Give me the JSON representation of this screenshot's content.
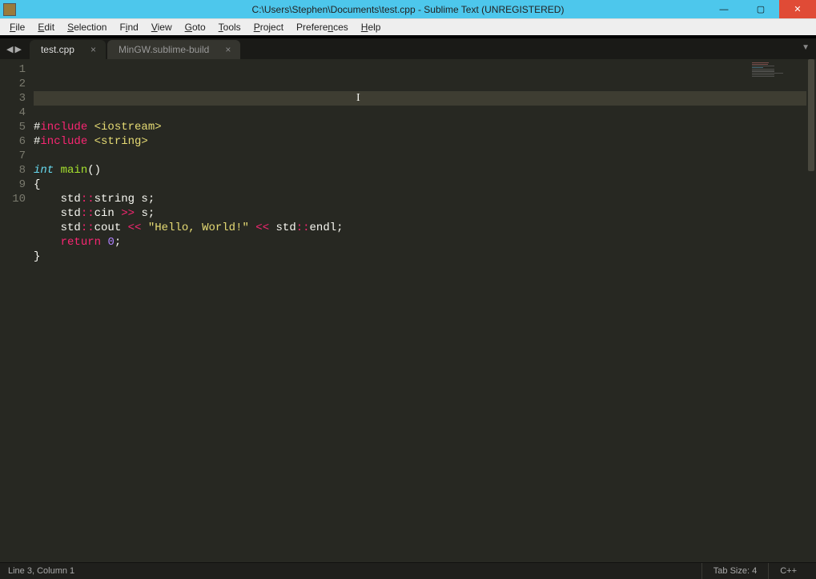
{
  "titlebar": {
    "title": "C:\\Users\\Stephen\\Documents\\test.cpp - Sublime Text (UNREGISTERED)"
  },
  "menu": {
    "items": [
      {
        "u": "F",
        "rest": "ile"
      },
      {
        "u": "E",
        "rest": "dit"
      },
      {
        "u": "S",
        "rest": "election"
      },
      {
        "u": "",
        "rest": "F",
        "u2": "i",
        "rest2": "nd"
      },
      {
        "u": "V",
        "rest": "iew"
      },
      {
        "u": "G",
        "rest": "oto"
      },
      {
        "u": "T",
        "rest": "ools"
      },
      {
        "u": "P",
        "rest": "roject"
      },
      {
        "u": "",
        "rest": "Prefere",
        "u2": "n",
        "rest2": "ces"
      },
      {
        "u": "H",
        "rest": "elp"
      }
    ]
  },
  "tabs": [
    {
      "label": "test.cpp",
      "active": true
    },
    {
      "label": "MinGW.sublime-build",
      "active": false
    }
  ],
  "code": {
    "lines": [
      {
        "n": "1",
        "segments": [
          {
            "cls": "tok-punct",
            "t": "#"
          },
          {
            "cls": "tok-include",
            "t": "include"
          },
          {
            "cls": "tok-punct",
            "t": " "
          },
          {
            "cls": "tok-header",
            "t": "<iostream>"
          }
        ]
      },
      {
        "n": "2",
        "segments": [
          {
            "cls": "tok-punct",
            "t": "#"
          },
          {
            "cls": "tok-include",
            "t": "include"
          },
          {
            "cls": "tok-punct",
            "t": " "
          },
          {
            "cls": "tok-header",
            "t": "<string>"
          }
        ]
      },
      {
        "n": "3",
        "segments": [],
        "current": true
      },
      {
        "n": "4",
        "segments": [
          {
            "cls": "tok-type",
            "t": "int"
          },
          {
            "cls": "tok-punct",
            "t": " "
          },
          {
            "cls": "tok-func",
            "t": "main"
          },
          {
            "cls": "tok-punct",
            "t": "()"
          }
        ]
      },
      {
        "n": "5",
        "segments": [
          {
            "cls": "tok-punct",
            "t": "{"
          }
        ]
      },
      {
        "n": "6",
        "segments": [
          {
            "cls": "tok-punct",
            "t": "    std"
          },
          {
            "cls": "tok-op",
            "t": "::"
          },
          {
            "cls": "tok-punct",
            "t": "string s;"
          }
        ]
      },
      {
        "n": "7",
        "segments": [
          {
            "cls": "tok-punct",
            "t": "    std"
          },
          {
            "cls": "tok-op",
            "t": "::"
          },
          {
            "cls": "tok-punct",
            "t": "cin "
          },
          {
            "cls": "tok-op",
            "t": ">>"
          },
          {
            "cls": "tok-punct",
            "t": " s;"
          }
        ]
      },
      {
        "n": "8",
        "segments": [
          {
            "cls": "tok-punct",
            "t": "    std"
          },
          {
            "cls": "tok-op",
            "t": "::"
          },
          {
            "cls": "tok-punct",
            "t": "cout "
          },
          {
            "cls": "tok-op",
            "t": "<<"
          },
          {
            "cls": "tok-punct",
            "t": " "
          },
          {
            "cls": "tok-string",
            "t": "\"Hello, World!\""
          },
          {
            "cls": "tok-punct",
            "t": " "
          },
          {
            "cls": "tok-op",
            "t": "<<"
          },
          {
            "cls": "tok-punct",
            "t": " std"
          },
          {
            "cls": "tok-op",
            "t": "::"
          },
          {
            "cls": "tok-punct",
            "t": "endl;"
          }
        ]
      },
      {
        "n": "9",
        "segments": [
          {
            "cls": "tok-punct",
            "t": "    "
          },
          {
            "cls": "tok-keyword",
            "t": "return"
          },
          {
            "cls": "tok-punct",
            "t": " "
          },
          {
            "cls": "tok-number",
            "t": "0"
          },
          {
            "cls": "tok-punct",
            "t": ";"
          }
        ]
      },
      {
        "n": "10",
        "segments": [
          {
            "cls": "tok-punct",
            "t": "}"
          }
        ]
      }
    ]
  },
  "status": {
    "position": "Line 3, Column 1",
    "tabsize": "Tab Size: 4",
    "syntax": "C++"
  },
  "winbuttons": {
    "min": "—",
    "max": "▢",
    "close": "✕"
  },
  "tabnav": {
    "back": "◀",
    "fwd": "▶"
  },
  "tabchevron": "▼",
  "tabclose": "×"
}
